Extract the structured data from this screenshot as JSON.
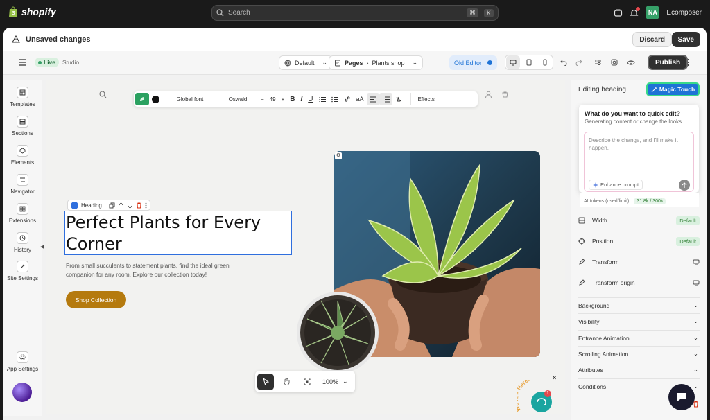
{
  "topbar": {
    "brand": "shopify",
    "search_placeholder": "Search",
    "shortcut_1": "⌘",
    "shortcut_2": "K",
    "avatar_initials": "NA",
    "store_name": "Ecomposer"
  },
  "unsaved": {
    "message": "Unsaved changes",
    "discard_label": "Discard",
    "save_label": "Save"
  },
  "editorbar": {
    "live_label": "Live",
    "studio_label": "Studio",
    "theme_select": "Default",
    "pages_label": "Pages",
    "page_select": "Plants shop",
    "old_editor_label": "Old Editor",
    "publish_label": "Publish"
  },
  "sidebar": {
    "items": [
      {
        "label": "Templates",
        "icon": "templates-icon"
      },
      {
        "label": "Sections",
        "icon": "sections-icon"
      },
      {
        "label": "Elements",
        "icon": "elements-icon"
      },
      {
        "label": "Navigator",
        "icon": "navigator-icon"
      },
      {
        "label": "Extensions",
        "icon": "extensions-icon"
      },
      {
        "label": "History",
        "icon": "history-icon"
      },
      {
        "label": "Site Settings",
        "icon": "site-settings-icon"
      }
    ],
    "app_settings_label": "App Settings"
  },
  "text_toolbar": {
    "font_scope": "Global font",
    "font_family": "Oswald",
    "font_size": "49",
    "effects_label": "Effects"
  },
  "canvas": {
    "element_tag": "Heading",
    "heading_line1": "Perfect Plants for Every",
    "heading_line2": "Corner",
    "paragraph": "From small succulents to statement plants, find the ideal green companion for any room. Explore our collection today!",
    "button_label": "Shop Collection",
    "zoom_level": "100%",
    "badge_text": "We Are Here!",
    "notification_count": "1"
  },
  "right_panel": {
    "title": "Editing heading",
    "magic_touch_label": "Magic Touch",
    "popover": {
      "title": "What do you want to quick edit?",
      "subtitle": "Generating content or change the looks",
      "placeholder": "Describe the change, and I'll make it happen.",
      "enhance_label": "Enhance prompt",
      "tokens_label": "AI tokens (used/limit):",
      "tokens_value": "31.8k / 300k"
    },
    "properties": [
      {
        "label": "Width",
        "value": "Default"
      },
      {
        "label": "Position",
        "value": "Default"
      },
      {
        "label": "Transform",
        "value": ""
      },
      {
        "label": "Transform origin",
        "value": ""
      }
    ],
    "sections": [
      "Background",
      "Visibility",
      "Entrance Animation",
      "Scrolling Animation",
      "Attributes",
      "Conditions"
    ]
  },
  "colors": {
    "accent_blue": "#1e73d6",
    "live_green": "#36a068",
    "cta_gold": "#b57a0e"
  }
}
